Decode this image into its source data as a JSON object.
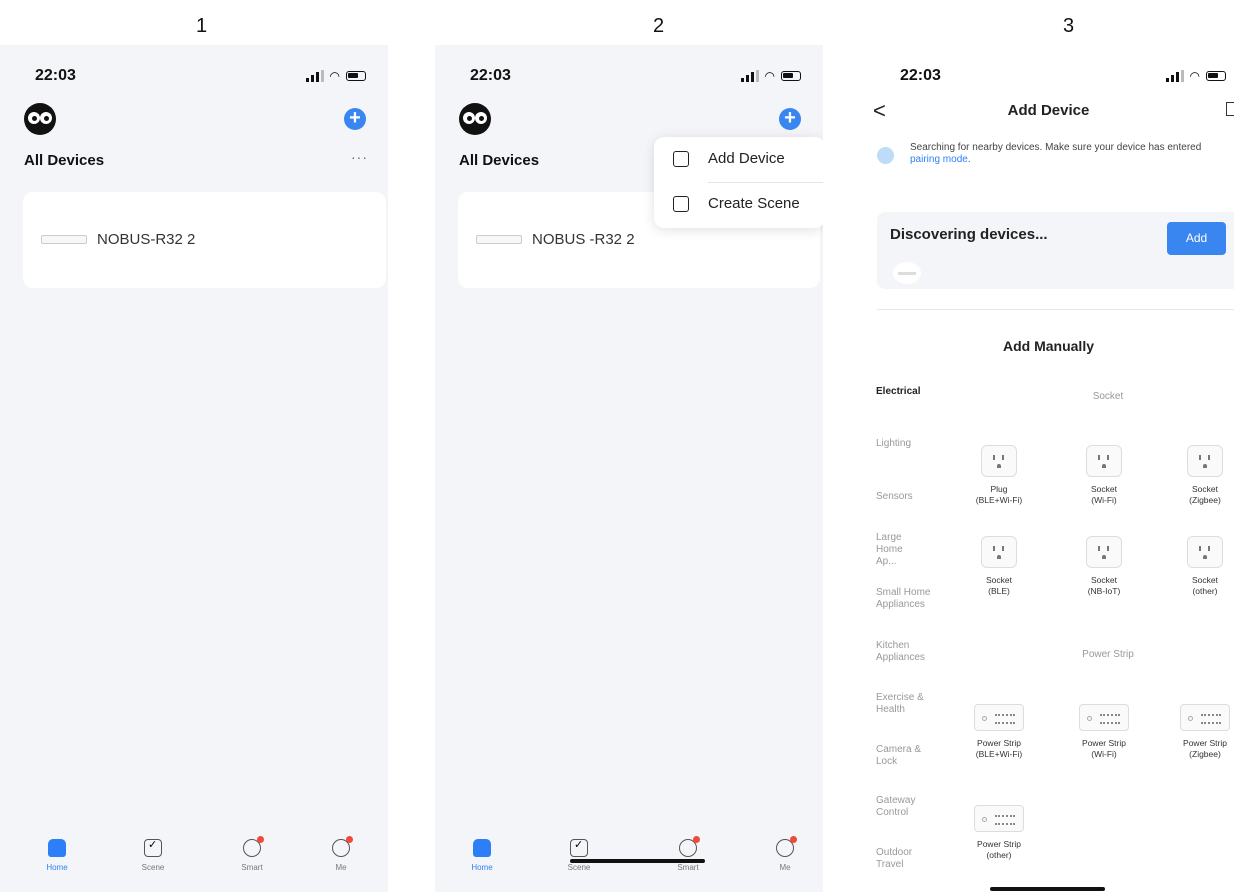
{
  "steps": [
    "1",
    "2",
    "3"
  ],
  "status": {
    "time": "22:03"
  },
  "home": {
    "title": "All Devices",
    "more": "···",
    "plus": "+",
    "device_name": "NOBUS-R32 2",
    "device_name_alt": "NOBUS -R32 2"
  },
  "tabs": [
    {
      "label": "Home",
      "icon": "home-icon"
    },
    {
      "label": "Scene",
      "icon": "scene-icon"
    },
    {
      "label": "Smart",
      "icon": "smart-icon"
    },
    {
      "label": "Me",
      "icon": "profile-icon"
    }
  ],
  "menu": {
    "items": [
      {
        "label": "Add Device",
        "icon": "add-device-icon"
      },
      {
        "label": "Create Scene",
        "icon": "create-scene-icon"
      }
    ]
  },
  "add_device": {
    "back": "<",
    "title": "Add Device",
    "search_text": "Searching for nearby devices. Make sure your device has entered ",
    "search_link": "pairing mode",
    "search_end": ".",
    "discover_title": "Discovering devices...",
    "add_button": "Add",
    "manual_title": "Add Manually",
    "categories": [
      "Electrical",
      "Lighting",
      "Sensors",
      "Large Home Ap...",
      "Small Home Appliances",
      "Kitchen Appliances",
      "Exercise & Health",
      "Camera & Lock",
      "Gateway Control",
      "Outdoor Travel"
    ],
    "sections": {
      "socket": {
        "title": "Socket",
        "items": [
          {
            "name": "Plug",
            "sub": "(BLE+Wi-Fi)"
          },
          {
            "name": "Socket",
            "sub": "(Wi-Fi)"
          },
          {
            "name": "Socket",
            "sub": "(Zigbee)"
          },
          {
            "name": "Socket",
            "sub": "(BLE)"
          },
          {
            "name": "Socket",
            "sub": "(NB-IoT)"
          },
          {
            "name": "Socket",
            "sub": "(other)"
          }
        ]
      },
      "strip": {
        "title": "Power Strip",
        "items": [
          {
            "name": "Power Strip",
            "sub": "(BLE+Wi-Fi)"
          },
          {
            "name": "Power Strip",
            "sub": "(Wi-Fi)"
          },
          {
            "name": "Power Strip",
            "sub": "(Zigbee)"
          },
          {
            "name": "Power Strip",
            "sub": "(other)"
          }
        ]
      }
    }
  },
  "colors": {
    "accent": "#2d7ff9",
    "badge": "#f04a3a",
    "bg": "#f4f5f8"
  }
}
